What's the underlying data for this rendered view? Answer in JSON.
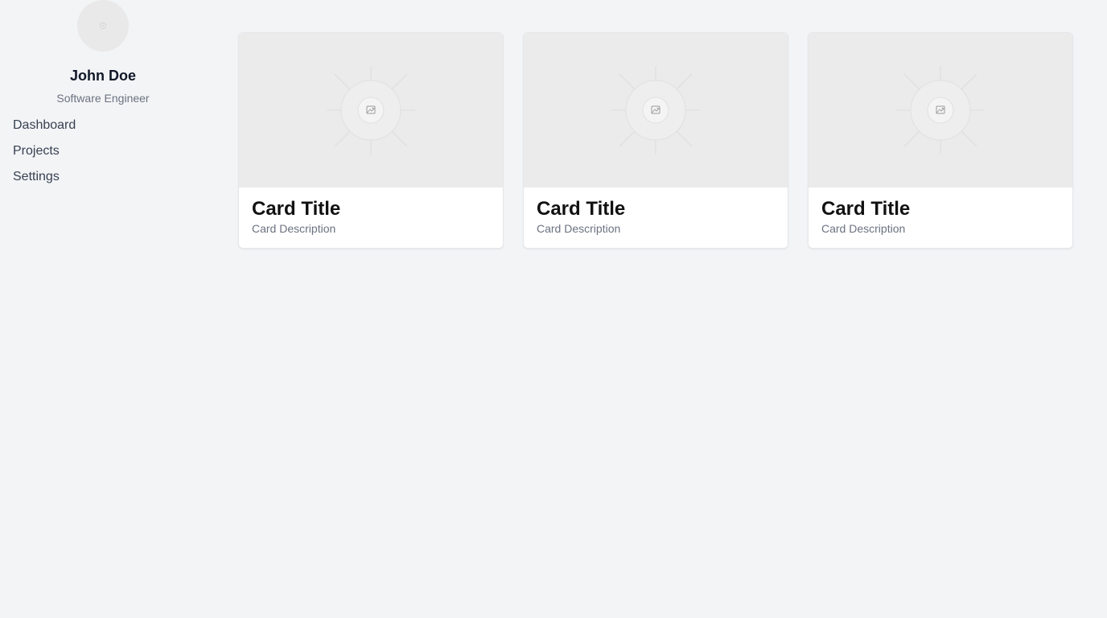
{
  "profile": {
    "name": "John Doe",
    "role": "Software Engineer"
  },
  "nav": {
    "items": [
      {
        "label": "Dashboard"
      },
      {
        "label": "Projects"
      },
      {
        "label": "Settings"
      }
    ]
  },
  "cards": [
    {
      "title": "Card Title",
      "description": "Card Description",
      "image_icon": "image-placeholder-icon"
    },
    {
      "title": "Card Title",
      "description": "Card Description",
      "image_icon": "image-placeholder-icon"
    },
    {
      "title": "Card Title",
      "description": "Card Description",
      "image_icon": "image-placeholder-icon"
    }
  ],
  "colors": {
    "background": "#f3f4f6",
    "card_background": "#ffffff",
    "placeholder": "#ebebeb",
    "text_primary": "#111827",
    "text_secondary": "#6b7280"
  }
}
